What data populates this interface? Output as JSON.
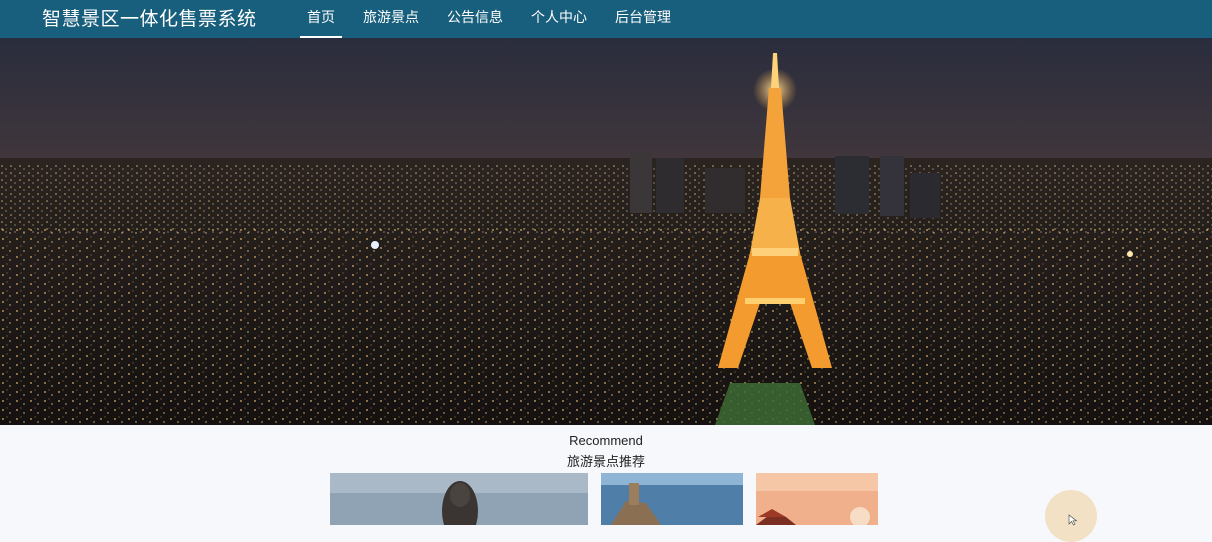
{
  "brand": {
    "title": "智慧景区一体化售票系统"
  },
  "nav": {
    "items": [
      {
        "label": "首页",
        "active": true
      },
      {
        "label": "旅游景点",
        "active": false
      },
      {
        "label": "公告信息",
        "active": false
      },
      {
        "label": "个人中心",
        "active": false
      },
      {
        "label": "后台管理",
        "active": false
      }
    ]
  },
  "hero": {
    "slide_count": 3,
    "active_slide": 1
  },
  "recommend": {
    "title_en": "Recommend",
    "title_cn": "旅游景点推荐"
  },
  "colors": {
    "topbar": "#175f7c",
    "fab": "#f2e1c4"
  }
}
